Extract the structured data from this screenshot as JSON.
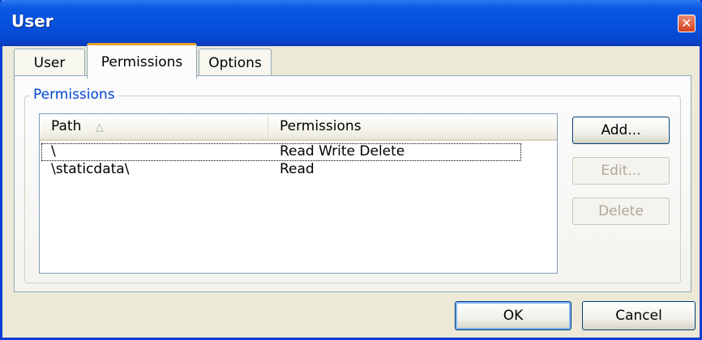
{
  "window": {
    "title": "User",
    "close_symbol": "✕"
  },
  "tabs": [
    {
      "label": "User",
      "active": false
    },
    {
      "label": "Permissions",
      "active": true
    },
    {
      "label": "Options",
      "active": false
    }
  ],
  "permissions_group": {
    "legend": "Permissions",
    "columns": {
      "path": "Path",
      "permissions": "Permissions",
      "sort_indicator": "△"
    },
    "rows": [
      {
        "path": "\\",
        "permissions": "Read Write Delete",
        "focused": true
      },
      {
        "path": "\\staticdata\\",
        "permissions": "Read",
        "focused": false
      }
    ],
    "buttons": {
      "add": "Add...",
      "edit": "Edit...",
      "delete": "Delete"
    }
  },
  "footer": {
    "ok": "OK",
    "cancel": "Cancel"
  },
  "colors": {
    "titlebar": "#0550dc",
    "legend": "#0046d5",
    "active_tab_accent": "#e2a12a",
    "face": "#ece9d8"
  }
}
